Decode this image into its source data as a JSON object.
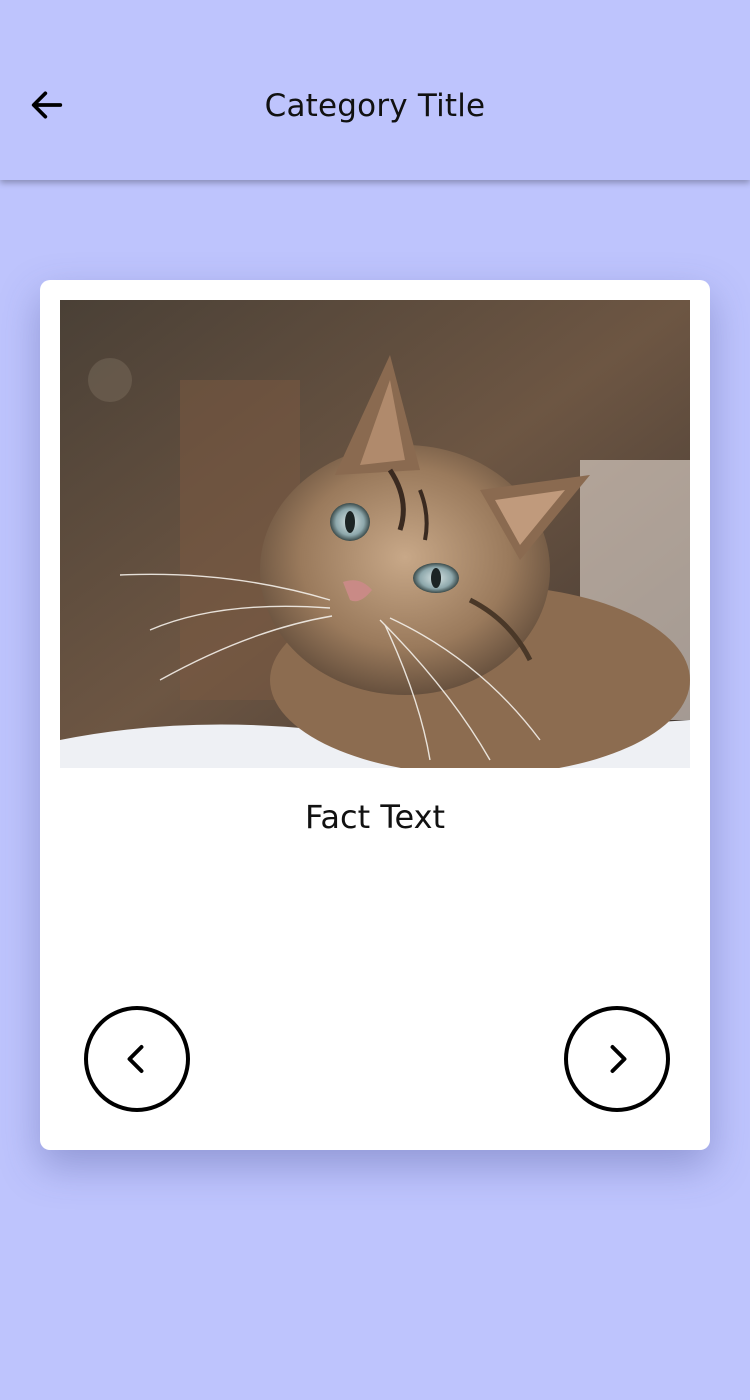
{
  "header": {
    "title": "Category Title",
    "back_icon": "arrow-left-icon"
  },
  "card": {
    "image_icon": "cat-photo",
    "fact_text": "Fact Text",
    "prev_icon": "chevron-left-icon",
    "next_icon": "chevron-right-icon"
  },
  "colors": {
    "background": "#bec4fd",
    "card": "#ffffff",
    "text": "#111111"
  }
}
